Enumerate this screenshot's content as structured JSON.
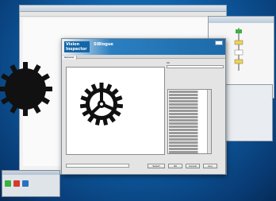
{
  "dialog": {
    "logo_line1": "Vision",
    "logo_line2": "Inspector",
    "title": "SlBlogue",
    "tabs": [
      "General"
    ],
    "side_label": "Ok",
    "buttons": [
      "Select",
      "OK",
      "Cancel",
      "Aus"
    ]
  },
  "bottom": {
    "caption": "",
    "corner": ""
  },
  "colors": {
    "desktop": "#0f5fa6",
    "dialog_header": "#1c6aa9",
    "task_green": "#3cb043",
    "task_red": "#d63a2f",
    "task_blue": "#2a6fc0"
  }
}
